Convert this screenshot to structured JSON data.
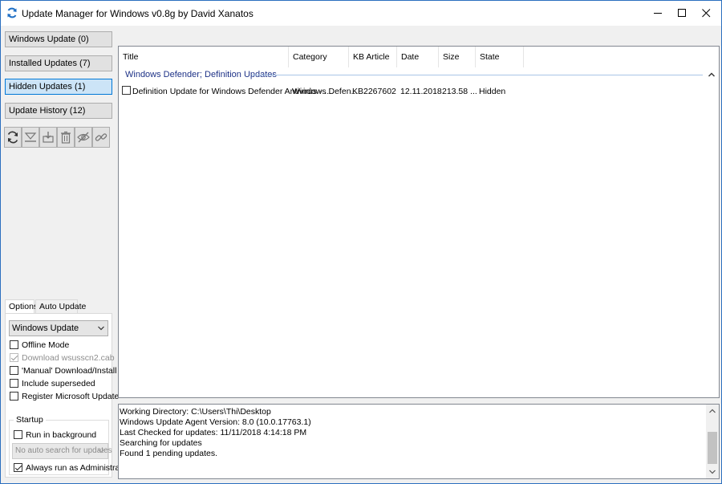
{
  "window": {
    "title": "Update Manager for Windows v0.8g by David Xanatos"
  },
  "nav": {
    "windows_update": "Windows Update (0)",
    "installed_updates": "Installed Updates (7)",
    "hidden_updates": "Hidden Updates (1)",
    "update_history": "Update History (12)",
    "active": "hidden_updates"
  },
  "toolbar": {
    "icons": [
      "refresh-icon",
      "download-icon",
      "install-icon",
      "delete-icon",
      "hide-icon",
      "link-icon"
    ]
  },
  "options": {
    "tabs": [
      "Options",
      "Auto Update"
    ],
    "active_tab": "Options",
    "source_select": "Windows Update",
    "offline_mode": {
      "label": "Offline Mode",
      "checked": false
    },
    "download_wsusscn2": {
      "label": "Download wsusscn2.cab",
      "checked": true,
      "disabled": true
    },
    "manual_download": {
      "label": "'Manual' Download/Install",
      "checked": false
    },
    "include_superseded": {
      "label": "Include superseded",
      "checked": false
    },
    "register_ms_update": {
      "label": "Register Microsoft Update",
      "checked": false
    },
    "startup": {
      "title": "Startup",
      "run_in_background": {
        "label": "Run in background",
        "checked": false
      },
      "auto_search_select": "No auto search for updates",
      "always_admin": {
        "label": "Always run as Administrator",
        "checked": true
      }
    }
  },
  "list": {
    "columns": [
      "Title",
      "Category",
      "KB Article",
      "Date",
      "Size",
      "State"
    ],
    "group": "Windows Defender; Definition Updates",
    "rows": [
      {
        "checked": false,
        "title": "Definition Update for Windows Defender Antivirus - ...",
        "category": "Windows Defen...",
        "kb": "KB2267602",
        "date": "12.11.2018",
        "size": "213.58 ...",
        "state": "Hidden"
      }
    ]
  },
  "log": {
    "lines": [
      "Working Directory: C:\\Users\\Thi\\Desktop",
      "Windows Update Agent Version: 8.0 (10.0.17763.1)",
      "Last Checked for updates: 11/11/2018 4:14:18 PM",
      "Searching for updates",
      "Found 1 pending updates."
    ]
  },
  "colors": {
    "accent_border": "#0078d7",
    "active_nav_bg": "#cce4f7",
    "group_header_text": "#1e3287"
  }
}
